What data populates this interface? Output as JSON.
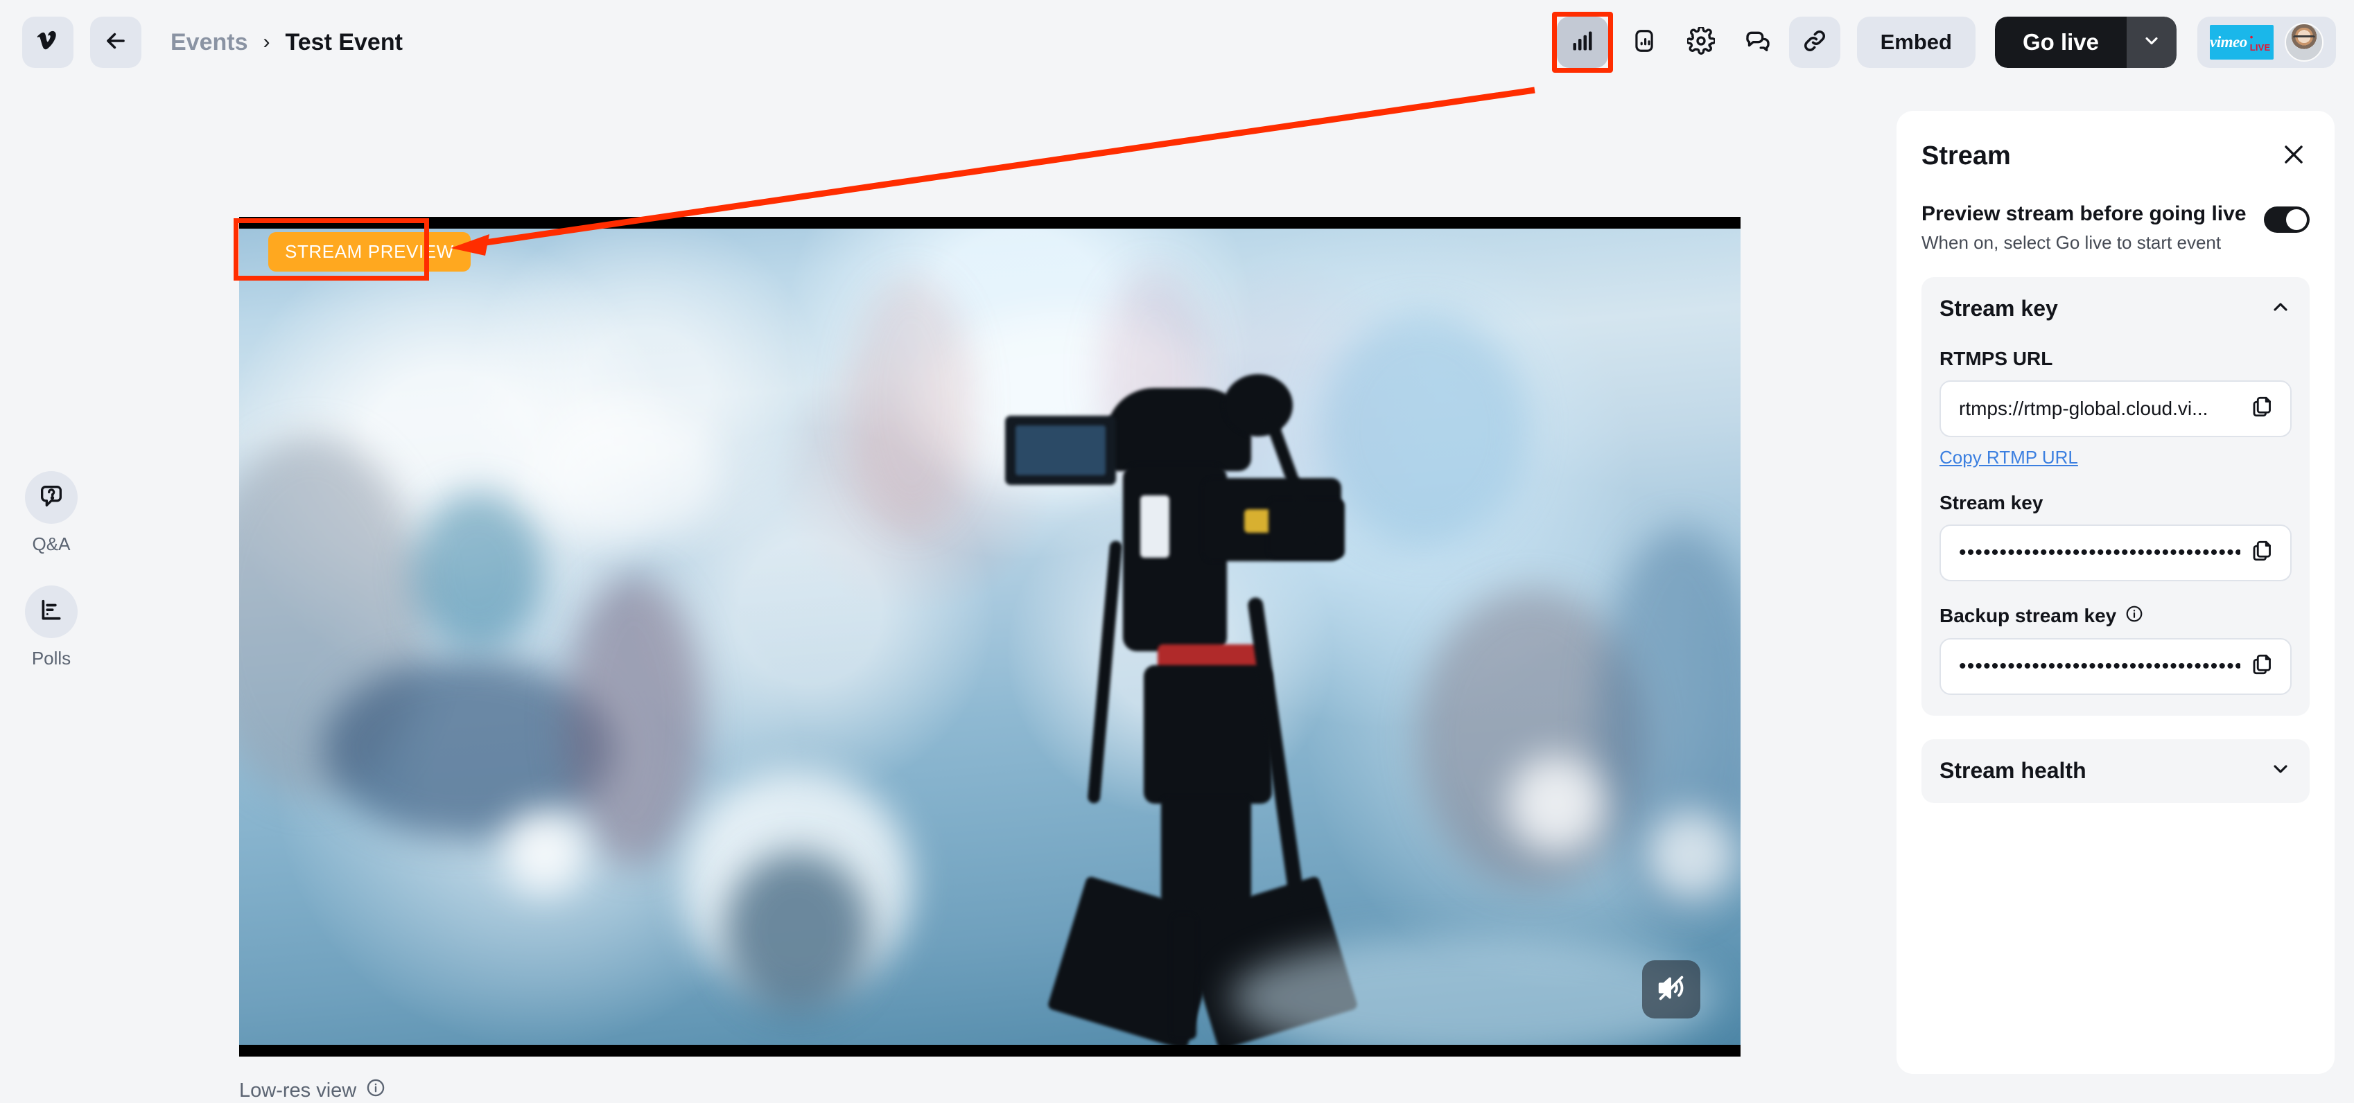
{
  "topbar": {
    "logo_icon": "vimeo-logo-icon",
    "back_icon": "arrow-left-icon",
    "breadcrumb": {
      "parent": "Events",
      "separator": "›",
      "current": "Test Event"
    },
    "tools": [
      {
        "name": "analytics-bars-icon",
        "label": "Analytics",
        "state": "active",
        "highlighted": true
      },
      {
        "name": "stats-panel-icon",
        "label": "Stats",
        "state": "default",
        "highlighted": false
      },
      {
        "name": "gear-icon",
        "label": "Settings",
        "state": "default",
        "highlighted": false
      },
      {
        "name": "chat-bubbles-icon",
        "label": "Chat",
        "state": "default",
        "highlighted": false
      },
      {
        "name": "link-icon",
        "label": "Share link",
        "state": "tinted",
        "highlighted": false
      }
    ],
    "embed_label": "Embed",
    "golive_label": "Go live",
    "golive_caret_icon": "chevron-down-icon",
    "account": {
      "badge_word": "vimeo",
      "badge_live": "• LIVE",
      "avatar": "user-avatar"
    }
  },
  "left_rail": [
    {
      "icon": "question-bubble-icon",
      "label": "Q&A"
    },
    {
      "icon": "poll-bars-icon",
      "label": "Polls"
    }
  ],
  "video": {
    "preview_badge": "STREAM PREVIEW",
    "mute_icon": "speaker-muted-icon",
    "lowres_label": "Low-res view",
    "lowres_info_icon": "info-icon",
    "highlight_color": "#ff2d00",
    "badge_color": "#ffa81f"
  },
  "panel": {
    "title": "Stream",
    "close_icon": "close-icon",
    "preview_toggle": {
      "title": "Preview stream before going live",
      "subtitle": "When on, select Go live to start event",
      "state": "on"
    },
    "stream_key_section": {
      "title": "Stream key",
      "collapse_icon": "chevron-up-icon",
      "fields": [
        {
          "label": "RTMPS URL",
          "value": "rtmps://rtmp-global.cloud.vi...",
          "copy_icon": "copy-icon",
          "link": "Copy RTMP URL",
          "masked": false,
          "info": false
        },
        {
          "label": "Stream key",
          "value": "••••••••••••••••••••••••••••••••••••••",
          "copy_icon": "copy-icon",
          "link": "",
          "masked": true,
          "info": false
        },
        {
          "label": "Backup stream key",
          "value": "••••••••••••••••••••••••••••••••••••••",
          "copy_icon": "copy-icon",
          "link": "",
          "masked": true,
          "info": true,
          "info_icon": "info-icon"
        }
      ]
    },
    "stream_health_section": {
      "title": "Stream health",
      "expand_icon": "chevron-down-icon"
    }
  }
}
